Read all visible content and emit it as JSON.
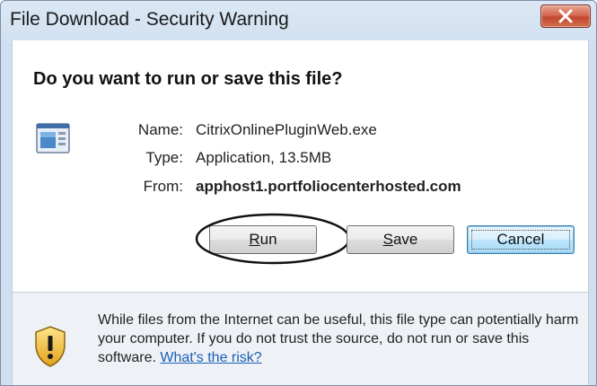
{
  "window": {
    "title": "File Download - Security Warning"
  },
  "dialog": {
    "question": "Do you want to run or save this file?",
    "file_icon": "application-icon",
    "info": [
      {
        "label": "Name:",
        "value": "CitrixOnlinePluginWeb.exe"
      },
      {
        "label": "Type:",
        "value": "Application, 13.5MB"
      },
      {
        "label": "From:",
        "value": "apphost1.portfoliocenterhosted.com"
      }
    ]
  },
  "buttons": {
    "run": {
      "accel": "R",
      "rest": "un"
    },
    "save": {
      "accel": "S",
      "rest": "ave"
    },
    "cancel": "Cancel"
  },
  "warning": {
    "icon": "shield-warning-icon",
    "text": "While files from the Internet can be useful, this file type can potentially harm your computer. If you do not trust the source, do not run or save this software.",
    "link": "What's the risk?"
  },
  "colors": {
    "close_button": "#c2472e",
    "link": "#1a5fb4",
    "default_button_border": "#3c7fb1",
    "shield_yellow": "#f2c23a"
  }
}
